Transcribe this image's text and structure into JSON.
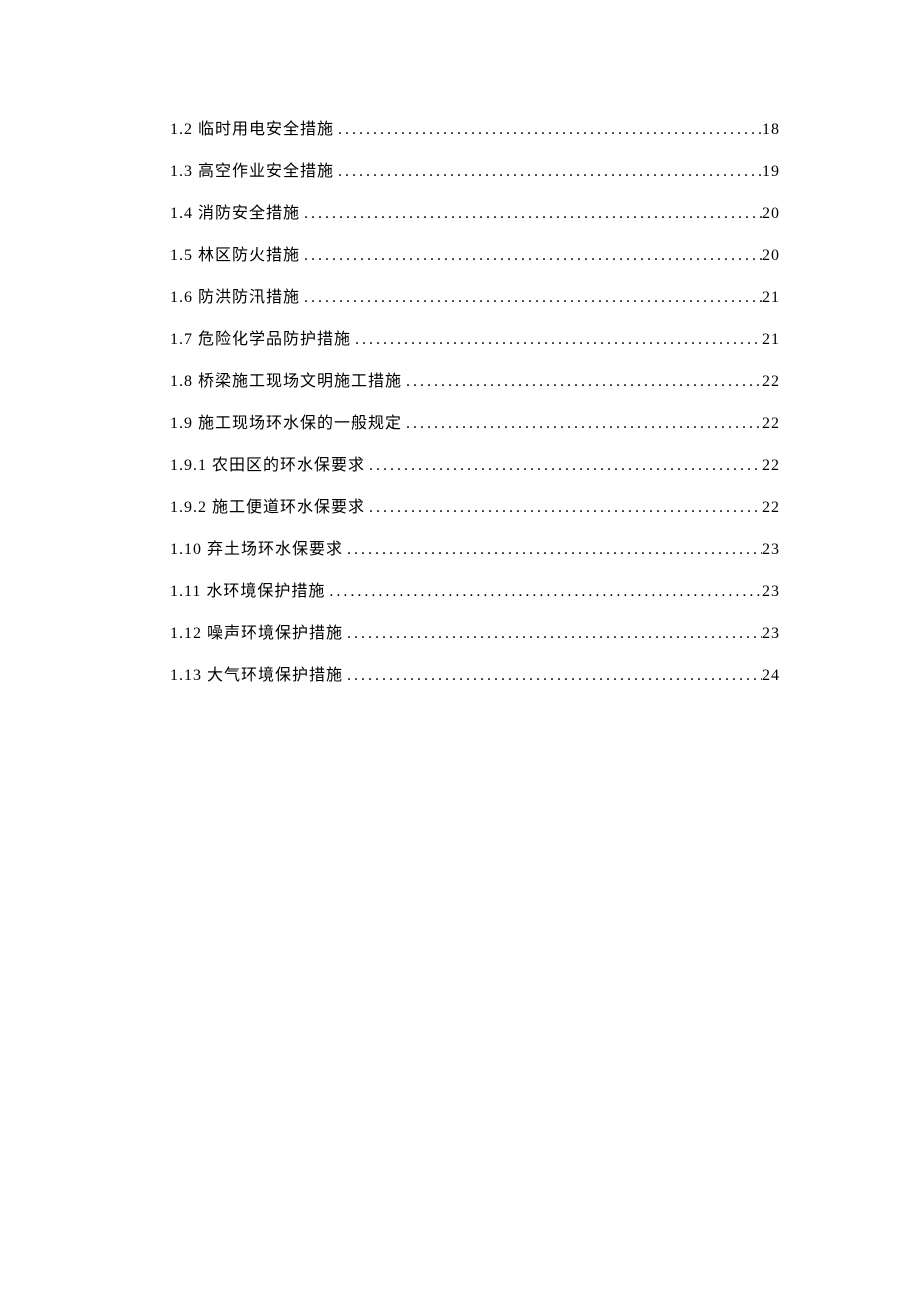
{
  "toc": [
    {
      "label": "1.2 临时用电安全措施",
      "page": "18"
    },
    {
      "label": "1.3 高空作业安全措施",
      "page": "19"
    },
    {
      "label": "1.4 消防安全措施",
      "page": "20"
    },
    {
      "label": "1.5  林区防火措施",
      "page": "20"
    },
    {
      "label": "1.6  防洪防汛措施",
      "page": "21"
    },
    {
      "label": "1.7 危险化学品防护措施",
      "page": "21"
    },
    {
      "label": "1.8  桥梁施工现场文明施工措施",
      "page": "22"
    },
    {
      "label": "1.9 施工现场环水保的一般规定",
      "page": "22"
    },
    {
      "label": "1.9.1 农田区的环水保要求",
      "page": "22"
    },
    {
      "label": "1.9.2 施工便道环水保要求",
      "page": "22"
    },
    {
      "label": "1.10 弃土场环水保要求",
      "page": "23"
    },
    {
      "label": "1.11 水环境保护措施",
      "page": "23"
    },
    {
      "label": "1.12 噪声环境保护措施",
      "page": "23"
    },
    {
      "label": "1.13 大气环境保护措施",
      "page": "24"
    }
  ]
}
